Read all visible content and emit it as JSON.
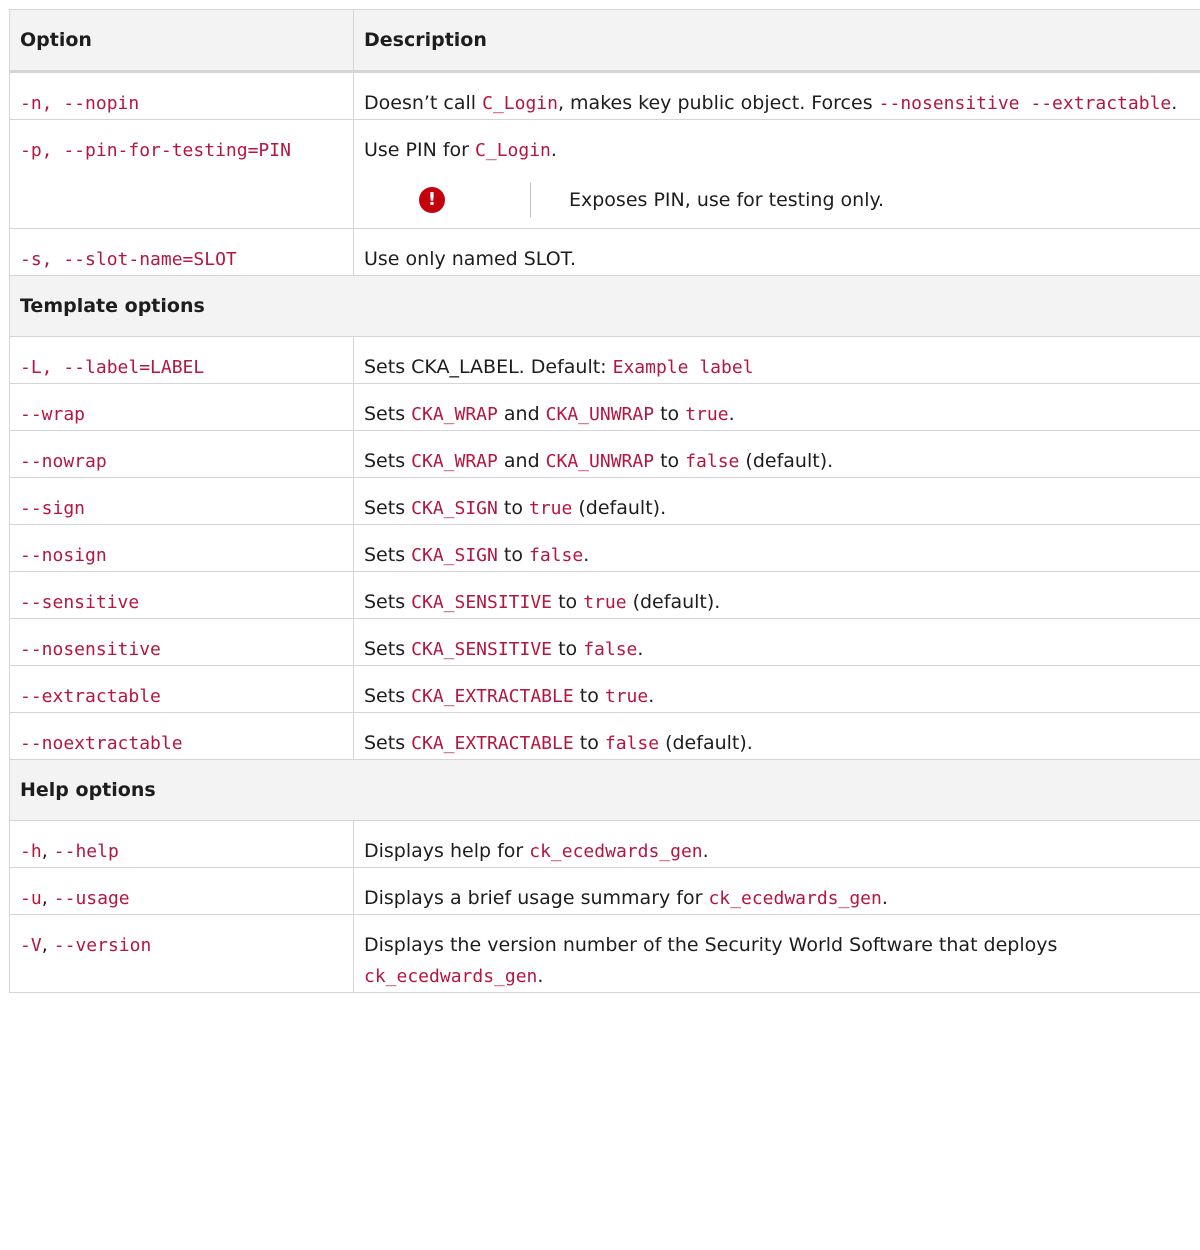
{
  "header": {
    "option": "Option",
    "description": "Description"
  },
  "rows": {
    "nopin": {
      "opt": [
        {
          "t": "-n, --nopin",
          "c": 1
        }
      ],
      "desc": [
        {
          "t": "Doesn’t call ",
          "c": 0
        },
        {
          "t": "C_Login",
          "c": 1
        },
        {
          "t": ", makes key public object. Forces ",
          "c": 0
        },
        {
          "t": "--nosensitive --extractable",
          "c": 1
        },
        {
          "t": ".",
          "c": 0
        }
      ]
    },
    "pin": {
      "opt": [
        {
          "t": "-p, --pin-for-testing=PIN",
          "c": 1
        }
      ],
      "desc": [
        {
          "t": "Use PIN for ",
          "c": 0
        },
        {
          "t": "C_Login",
          "c": 1
        },
        {
          "t": ".",
          "c": 0
        }
      ],
      "note_icon": "exclamation-icon",
      "note_icon_glyph": "!",
      "note_text": "Exposes PIN, use for testing only."
    },
    "slot": {
      "opt": [
        {
          "t": "-s, --slot-name=SLOT",
          "c": 1
        }
      ],
      "desc": [
        {
          "t": "Use only named SLOT.",
          "c": 0
        }
      ]
    }
  },
  "template_section": {
    "title": "Template options",
    "rows": [
      {
        "opt": [
          {
            "t": "-L, --label=LABEL",
            "c": 1
          }
        ],
        "desc": [
          {
            "t": "Sets CKA_LABEL. Default: ",
            "c": 0
          },
          {
            "t": "Example label",
            "c": 1
          }
        ]
      },
      {
        "opt": [
          {
            "t": "--wrap",
            "c": 1
          }
        ],
        "desc": [
          {
            "t": "Sets ",
            "c": 0
          },
          {
            "t": "CKA_WRAP",
            "c": 1
          },
          {
            "t": " and ",
            "c": 0
          },
          {
            "t": "CKA_UNWRAP",
            "c": 1
          },
          {
            "t": " to ",
            "c": 0
          },
          {
            "t": "true",
            "c": 1
          },
          {
            "t": ".",
            "c": 0
          }
        ]
      },
      {
        "opt": [
          {
            "t": "--nowrap",
            "c": 1
          }
        ],
        "desc": [
          {
            "t": "Sets ",
            "c": 0
          },
          {
            "t": "CKA_WRAP",
            "c": 1
          },
          {
            "t": " and ",
            "c": 0
          },
          {
            "t": "CKA_UNWRAP",
            "c": 1
          },
          {
            "t": " to ",
            "c": 0
          },
          {
            "t": "false",
            "c": 1
          },
          {
            "t": " (default).",
            "c": 0
          }
        ]
      },
      {
        "opt": [
          {
            "t": "--sign",
            "c": 1
          }
        ],
        "desc": [
          {
            "t": "Sets ",
            "c": 0
          },
          {
            "t": "CKA_SIGN",
            "c": 1
          },
          {
            "t": " to ",
            "c": 0
          },
          {
            "t": "true",
            "c": 1
          },
          {
            "t": " (default).",
            "c": 0
          }
        ]
      },
      {
        "opt": [
          {
            "t": "--nosign",
            "c": 1
          }
        ],
        "desc": [
          {
            "t": "Sets ",
            "c": 0
          },
          {
            "t": "CKA_SIGN",
            "c": 1
          },
          {
            "t": " to ",
            "c": 0
          },
          {
            "t": "false",
            "c": 1
          },
          {
            "t": ".",
            "c": 0
          }
        ]
      },
      {
        "opt": [
          {
            "t": "--sensitive",
            "c": 1
          }
        ],
        "desc": [
          {
            "t": "Sets ",
            "c": 0
          },
          {
            "t": "CKA_SENSITIVE",
            "c": 1
          },
          {
            "t": " to ",
            "c": 0
          },
          {
            "t": "true",
            "c": 1
          },
          {
            "t": " (default).",
            "c": 0
          }
        ]
      },
      {
        "opt": [
          {
            "t": "--nosensitive",
            "c": 1
          }
        ],
        "desc": [
          {
            "t": "Sets ",
            "c": 0
          },
          {
            "t": "CKA_SENSITIVE",
            "c": 1
          },
          {
            "t": " to ",
            "c": 0
          },
          {
            "t": "false",
            "c": 1
          },
          {
            "t": ".",
            "c": 0
          }
        ]
      },
      {
        "opt": [
          {
            "t": "--extractable",
            "c": 1
          }
        ],
        "desc": [
          {
            "t": "Sets ",
            "c": 0
          },
          {
            "t": "CKA_EXTRACTABLE",
            "c": 1
          },
          {
            "t": " to ",
            "c": 0
          },
          {
            "t": "true",
            "c": 1
          },
          {
            "t": ".",
            "c": 0
          }
        ]
      },
      {
        "opt": [
          {
            "t": "--noextractable",
            "c": 1
          }
        ],
        "desc": [
          {
            "t": "Sets ",
            "c": 0
          },
          {
            "t": "CKA_EXTRACTABLE",
            "c": 1
          },
          {
            "t": " to ",
            "c": 0
          },
          {
            "t": "false",
            "c": 1
          },
          {
            "t": " (default).",
            "c": 0
          }
        ]
      }
    ]
  },
  "help_section": {
    "title": "Help options",
    "rows": [
      {
        "opt": [
          {
            "t": "-h",
            "c": 1
          },
          {
            "t": ", ",
            "c": 0
          },
          {
            "t": "--help",
            "c": 1
          }
        ],
        "desc": [
          {
            "t": "Displays help for ",
            "c": 0
          },
          {
            "t": "ck_ecedwards_gen",
            "c": 1
          },
          {
            "t": ".",
            "c": 0
          }
        ]
      },
      {
        "opt": [
          {
            "t": "-u",
            "c": 1
          },
          {
            "t": ", ",
            "c": 0
          },
          {
            "t": "--usage",
            "c": 1
          }
        ],
        "desc": [
          {
            "t": "Displays a brief usage summary for ",
            "c": 0
          },
          {
            "t": "ck_ecedwards_gen",
            "c": 1
          },
          {
            "t": ".",
            "c": 0
          }
        ]
      },
      {
        "opt": [
          {
            "t": "-V",
            "c": 1
          },
          {
            "t": ", ",
            "c": 0
          },
          {
            "t": "--version",
            "c": 1
          }
        ],
        "desc": [
          {
            "t": "Displays the version number of the Security World Software that deploys ",
            "c": 0
          },
          {
            "t": "ck_ecedwards_gen",
            "c": 1
          },
          {
            "t": ".",
            "c": 0
          }
        ]
      }
    ]
  },
  "colors": {
    "code": "#b5163f",
    "warning": "#c4000d",
    "header_bg": "#f3f3f3",
    "border": "#d5d5d5"
  }
}
